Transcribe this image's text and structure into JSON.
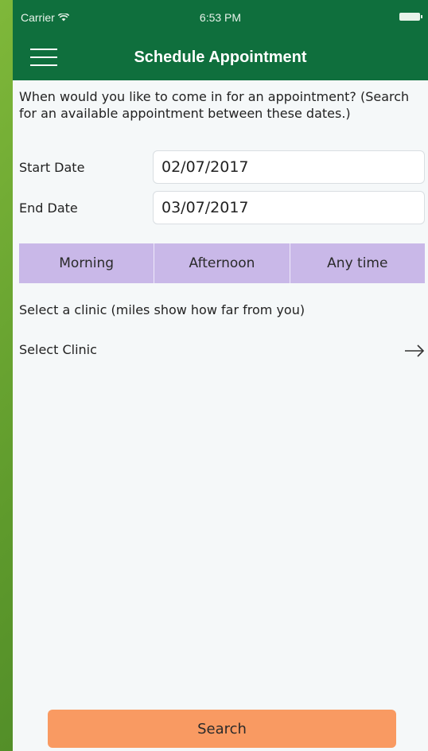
{
  "status_bar": {
    "carrier": "Carrier",
    "time": "6:53 PM"
  },
  "nav": {
    "title": "Schedule Appointment"
  },
  "form": {
    "intro": "When would you like to come in for an appointment? (Search for an available appointment between these dates.)",
    "start_date_label": "Start Date",
    "start_date_value": "02/07/2017",
    "end_date_label": "End Date",
    "end_date_value": "03/07/2017",
    "time_of_day_options": [
      "Morning",
      "Afternoon",
      "Any time"
    ],
    "clinic_hint": "Select a clinic (miles show how far from you)",
    "select_clinic_label": "Select Clinic",
    "search_label": "Search"
  },
  "colors": {
    "header": "#0f6f3d",
    "segment_bg": "#c9b8e8",
    "search_button": "#f99a62",
    "page_bg": "#f5f8f9"
  },
  "icons": {
    "menu": "hamburger-menu-icon",
    "wifi": "wifi-icon",
    "battery": "battery-icon",
    "arrow": "arrow-right-icon"
  }
}
